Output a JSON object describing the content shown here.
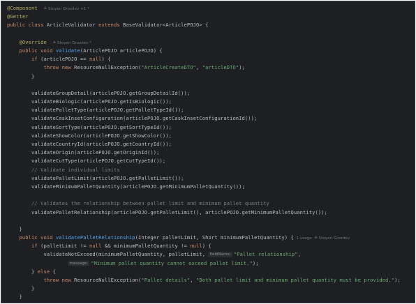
{
  "colors": {
    "background": "#1e1f22",
    "keyword": "#cf8e6d",
    "annotation": "#b3ae60",
    "method_declaration": "#56a8f5",
    "string": "#6aab73",
    "comment": "#7a7e85",
    "text": "#bcbec4",
    "inlay_hint": "#6f737a"
  },
  "lines": [
    {
      "tokens": [
        {
          "t": "@Component",
          "c": "ann"
        },
        {
          "t": "  ",
          "c": "plain"
        },
        {
          "t": "≙ Stoyan Grozdev +1 *",
          "c": "hint"
        }
      ]
    },
    {
      "tokens": [
        {
          "t": "@Getter",
          "c": "ann"
        }
      ]
    },
    {
      "tokens": [
        {
          "t": "public class ",
          "c": "kw"
        },
        {
          "t": "ArticleValidator ",
          "c": "plain"
        },
        {
          "t": "extends ",
          "c": "kw"
        },
        {
          "t": "BaseValidator<ArticlePOJO> {",
          "c": "plain"
        }
      ]
    },
    {
      "tokens": []
    },
    {
      "tokens": [
        {
          "t": "    @Override",
          "c": "ann"
        },
        {
          "t": "  ",
          "c": "plain"
        },
        {
          "t": "≙ Stoyan Grozdev *",
          "c": "hint"
        }
      ]
    },
    {
      "tokens": [
        {
          "t": "    public void ",
          "c": "kw"
        },
        {
          "t": "validate",
          "c": "fn-def"
        },
        {
          "t": "(ArticlePOJO articlePOJO) {",
          "c": "plain"
        }
      ]
    },
    {
      "tokens": [
        {
          "t": "        if ",
          "c": "kw"
        },
        {
          "t": "(articlePOJO == ",
          "c": "plain"
        },
        {
          "t": "null",
          "c": "kw"
        },
        {
          "t": ") {",
          "c": "plain"
        }
      ]
    },
    {
      "tokens": [
        {
          "t": "            throw new ",
          "c": "kw"
        },
        {
          "t": "ResourceNullException(",
          "c": "plain"
        },
        {
          "t": "\"ArticleCreateDTO\"",
          "c": "str"
        },
        {
          "t": ", ",
          "c": "plain"
        },
        {
          "t": "\"articleDTO\"",
          "c": "str"
        },
        {
          "t": ");",
          "c": "plain"
        }
      ]
    },
    {
      "tokens": [
        {
          "t": "        }",
          "c": "plain"
        }
      ]
    },
    {
      "tokens": []
    },
    {
      "tokens": [
        {
          "t": "        validateGroupDetail(articlePOJO.getGroupDetailId());",
          "c": "plain"
        }
      ]
    },
    {
      "tokens": [
        {
          "t": "        validateBiologic(articlePOJO.getIsBiologic());",
          "c": "plain"
        }
      ]
    },
    {
      "tokens": [
        {
          "t": "        validatePalletType(articlePOJO.getPalletTypeId());",
          "c": "plain"
        }
      ]
    },
    {
      "tokens": [
        {
          "t": "        validateCaskInsetConfiguration(articlePOJO.getCaskInsetConfigurationId());",
          "c": "plain"
        }
      ]
    },
    {
      "tokens": [
        {
          "t": "        validateSortType(articlePOJO.getSortTypeId());",
          "c": "plain"
        }
      ]
    },
    {
      "tokens": [
        {
          "t": "        validateShowColor(articlePOJO.getShowColor());",
          "c": "plain"
        }
      ]
    },
    {
      "tokens": [
        {
          "t": "        validateCountryId(articlePOJO.getCountryId());",
          "c": "plain"
        }
      ]
    },
    {
      "tokens": [
        {
          "t": "        validateOrigin(articlePOJO.getOriginId());",
          "c": "plain"
        }
      ]
    },
    {
      "tokens": [
        {
          "t": "        validateCutType(articlePOJO.getCutTypeId());",
          "c": "plain"
        }
      ]
    },
    {
      "tokens": [
        {
          "t": "        // Validate individual limits",
          "c": "cmt"
        }
      ]
    },
    {
      "tokens": [
        {
          "t": "        validatePalletLimit(articlePOJO.getPalletLimit());",
          "c": "plain"
        }
      ]
    },
    {
      "tokens": [
        {
          "t": "        validateMinimumPalletQuantity(articlePOJO.getMinimumPalletQuantity());",
          "c": "plain"
        }
      ]
    },
    {
      "tokens": []
    },
    {
      "tokens": [
        {
          "t": "        // Validates the relationship between pallet limit and minimum pallet quantity",
          "c": "cmt"
        }
      ]
    },
    {
      "tokens": [
        {
          "t": "        validatePalletRelationship(articlePOJO.getPalletLimit(), articlePOJO.getMinimumPalletQuantity());",
          "c": "plain"
        }
      ]
    },
    {
      "tokens": []
    },
    {
      "tokens": [
        {
          "t": "    }",
          "c": "plain"
        }
      ]
    },
    {
      "tokens": [
        {
          "t": "    public void ",
          "c": "kw"
        },
        {
          "t": "validatePalletRelationship",
          "c": "fn-def"
        },
        {
          "t": "(Integer palletLimit, Short minimumPalletQuantity) {",
          "c": "plain"
        },
        {
          "t": "  1 usage  ≙ Stoyan Grozdev",
          "c": "hint"
        }
      ]
    },
    {
      "tokens": [
        {
          "t": "        if ",
          "c": "kw"
        },
        {
          "t": "(palletLimit != ",
          "c": "plain"
        },
        {
          "t": "null",
          "c": "kw"
        },
        {
          "t": " && minimumPalletQuantity != ",
          "c": "plain"
        },
        {
          "t": "null",
          "c": "kw"
        },
        {
          "t": ") {",
          "c": "plain"
        }
      ]
    },
    {
      "tokens": [
        {
          "t": "            validateNotExceed(minimumPalletQuantity, palletLimit, ",
          "c": "plain"
        },
        {
          "t": "fieldName:",
          "c": "param"
        },
        {
          "t": "\"Pallet relationship\"",
          "c": "str"
        },
        {
          "t": ",",
          "c": "plain"
        }
      ]
    },
    {
      "tokens": [
        {
          "t": "                    ",
          "c": "plain"
        },
        {
          "t": "message:",
          "c": "param"
        },
        {
          "t": "\"Minimum pallet quantity cannot exceed pallet limit.\"",
          "c": "str"
        },
        {
          "t": ");",
          "c": "plain"
        }
      ]
    },
    {
      "tokens": [
        {
          "t": "        } ",
          "c": "plain"
        },
        {
          "t": "else ",
          "c": "kw"
        },
        {
          "t": "{",
          "c": "plain"
        }
      ]
    },
    {
      "tokens": [
        {
          "t": "            throw new ",
          "c": "kw"
        },
        {
          "t": "ResourceNullException(",
          "c": "plain"
        },
        {
          "t": "\"Pallet details\"",
          "c": "str"
        },
        {
          "t": ", ",
          "c": "plain"
        },
        {
          "t": "\"Both pallet limit and minimum pallet quantity must be provided.\"",
          "c": "str"
        },
        {
          "t": ");",
          "c": "plain"
        }
      ]
    },
    {
      "tokens": [
        {
          "t": "        }",
          "c": "plain"
        }
      ]
    },
    {
      "tokens": [
        {
          "t": "    }",
          "c": "plain"
        }
      ]
    }
  ]
}
